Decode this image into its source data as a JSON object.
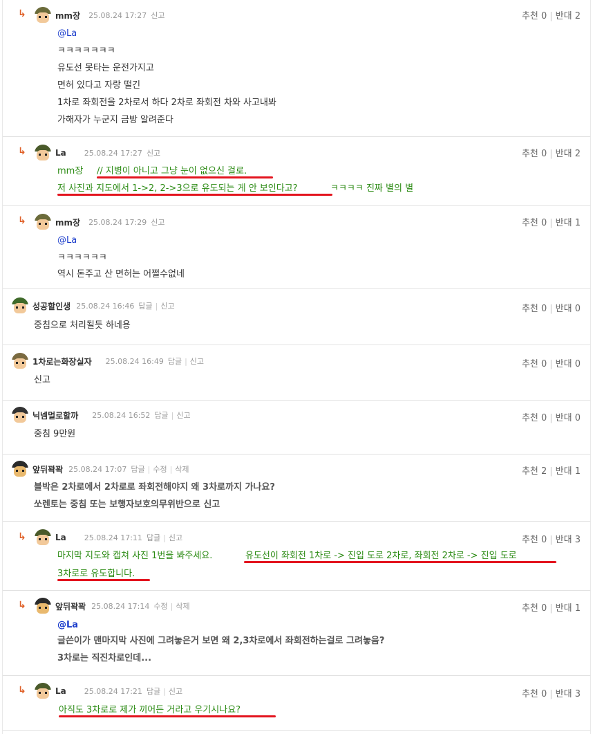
{
  "comments": [
    {
      "nick": "mm장",
      "datetime": "25.08.24 17:27",
      "actions": [
        "신고"
      ],
      "upvote": "추천 0",
      "downvote": "반대 2",
      "lines": [
        "@La",
        "ㅋㅋㅋㅋㅋㅋㅋ",
        "유도선 못타는 운전가지고",
        "면허 있다고 자랑 떨긴",
        "1차로 좌회전을 2차로서 하다 2차로 좌회전 차와 사고내봐",
        "가해자가 누군지 금방 알려준다"
      ]
    },
    {
      "nick": "La",
      "datetime": "25.08.24 17:27",
      "actions": [
        "신고"
      ],
      "upvote": "추천 0",
      "downvote": "반대 2",
      "line1_prefix": "mm장",
      "line1_main": "// 지병이 아니고 그냥 눈이 없으신 걸로.",
      "line2_main": "저 사진과 지도에서 1->2, 2->3으로 유도되는 게 안 보인다고?",
      "line2_tail": "ㅋㅋㅋㅋ 진짜 별의 별"
    },
    {
      "nick": "mm장",
      "datetime": "25.08.24 17:29",
      "actions": [
        "신고"
      ],
      "upvote": "추천 0",
      "downvote": "반대 1",
      "lines": [
        "@La",
        "ㅋㅋㅋㅋㅋㅋ",
        "역시 돈주고 산 면허는 어쩔수없네"
      ]
    },
    {
      "nick": "성공할인생",
      "datetime": "25.08.24 16:46",
      "actions": [
        "답글",
        "신고"
      ],
      "upvote": "추천 0",
      "downvote": "반대 0",
      "lines": [
        "중침으로 처리될듯 하네용"
      ]
    },
    {
      "nick": "1차로는화장실자",
      "datetime": "25.08.24 16:49",
      "actions": [
        "답글",
        "신고"
      ],
      "upvote": "추천 0",
      "downvote": "반대 0",
      "lines": [
        "신고"
      ]
    },
    {
      "nick": "닉넴멀로할까",
      "datetime": "25.08.24 16:52",
      "actions": [
        "답글",
        "신고"
      ],
      "upvote": "추천 0",
      "downvote": "반대 0",
      "lines": [
        "중침 9만원"
      ]
    },
    {
      "nick": "앞뒤꽉꽉",
      "datetime": "25.08.24 17:07",
      "actions": [
        "답글",
        "수정",
        "삭제"
      ],
      "upvote": "추천 2",
      "downvote": "반대 1",
      "lines": [
        "블박은 2차로에서 2차로로 좌회전해야지 왜 3차로까지 가나요?",
        "쏘렌토는 중침 또는 보행자보호의무위반으로 신고"
      ]
    },
    {
      "nick": "La",
      "datetime": "25.08.24 17:11",
      "actions": [
        "답글",
        "신고"
      ],
      "upvote": "추천 0",
      "downvote": "반대 3",
      "line1_prefix": "마지막 지도와 캡쳐 사진 1번을 봐주세요.",
      "line1_main": "유도선이 좌회전 1차로 -> 진입 도로 2차로, 좌회전 2차로 -> 진입 도로",
      "line2_main": "3차로로 유도합니다."
    },
    {
      "nick": "앞뒤꽉꽉",
      "datetime": "25.08.24 17:14",
      "actions": [
        "수정",
        "삭제"
      ],
      "upvote": "추천 0",
      "downvote": "반대 1",
      "lines": [
        "@La",
        "글쓴이가 맨마지막 사진에 그려놓은거 보면 왜 2,3차로에서 좌회전하는걸로 그려놓음?",
        "3차로는 직진차로인데..."
      ]
    },
    {
      "nick": "La",
      "datetime": "25.08.24 17:21",
      "actions": [
        "답글",
        "신고"
      ],
      "upvote": "추천 0",
      "downvote": "반대 3",
      "line1_main": "아직도 3차로로 제가 끼어든 거라고 우기시나요?"
    }
  ],
  "colors": {
    "mention": "#1a3ccb",
    "green_text": "#2a8a12",
    "underline": "#e3141e",
    "reply_arrow": "#e0622a"
  },
  "icons": {
    "reply": "reply-arrow-icon",
    "avatar": "avatar-icon"
  }
}
